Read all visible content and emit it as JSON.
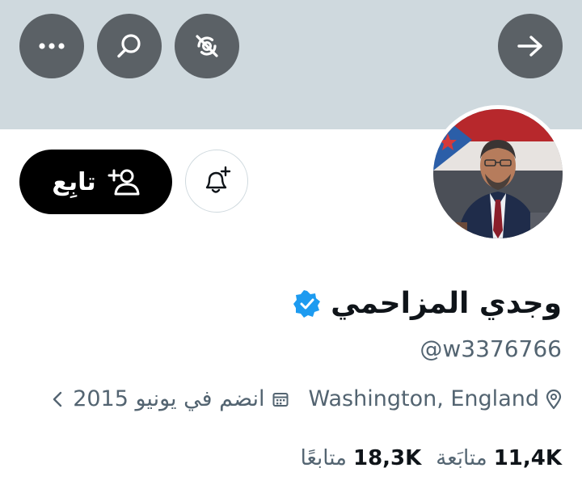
{
  "header": {
    "more_icon": "more-horizontal-icon",
    "search_icon": "search-icon",
    "topics_icon": "topics-muted-icon",
    "forward_icon": "arrow-right-icon"
  },
  "profile": {
    "display_name": "وجدي المزاحمي",
    "verified": true,
    "handle": "@w3376766",
    "location": "Washington, England",
    "joined": "انضم في يونيو 2015",
    "following_count": "11,4K",
    "following_label": "متابَعة",
    "followers_count": "18,3K",
    "followers_label": "متابعًا"
  },
  "actions": {
    "follow_label": "تابِع",
    "notify_icon": "bell-plus-icon"
  },
  "colors": {
    "banner": "#cfd9de",
    "header_button": "#5b6166",
    "verified_blue": "#1d9bf0",
    "secondary_text": "#536471"
  }
}
